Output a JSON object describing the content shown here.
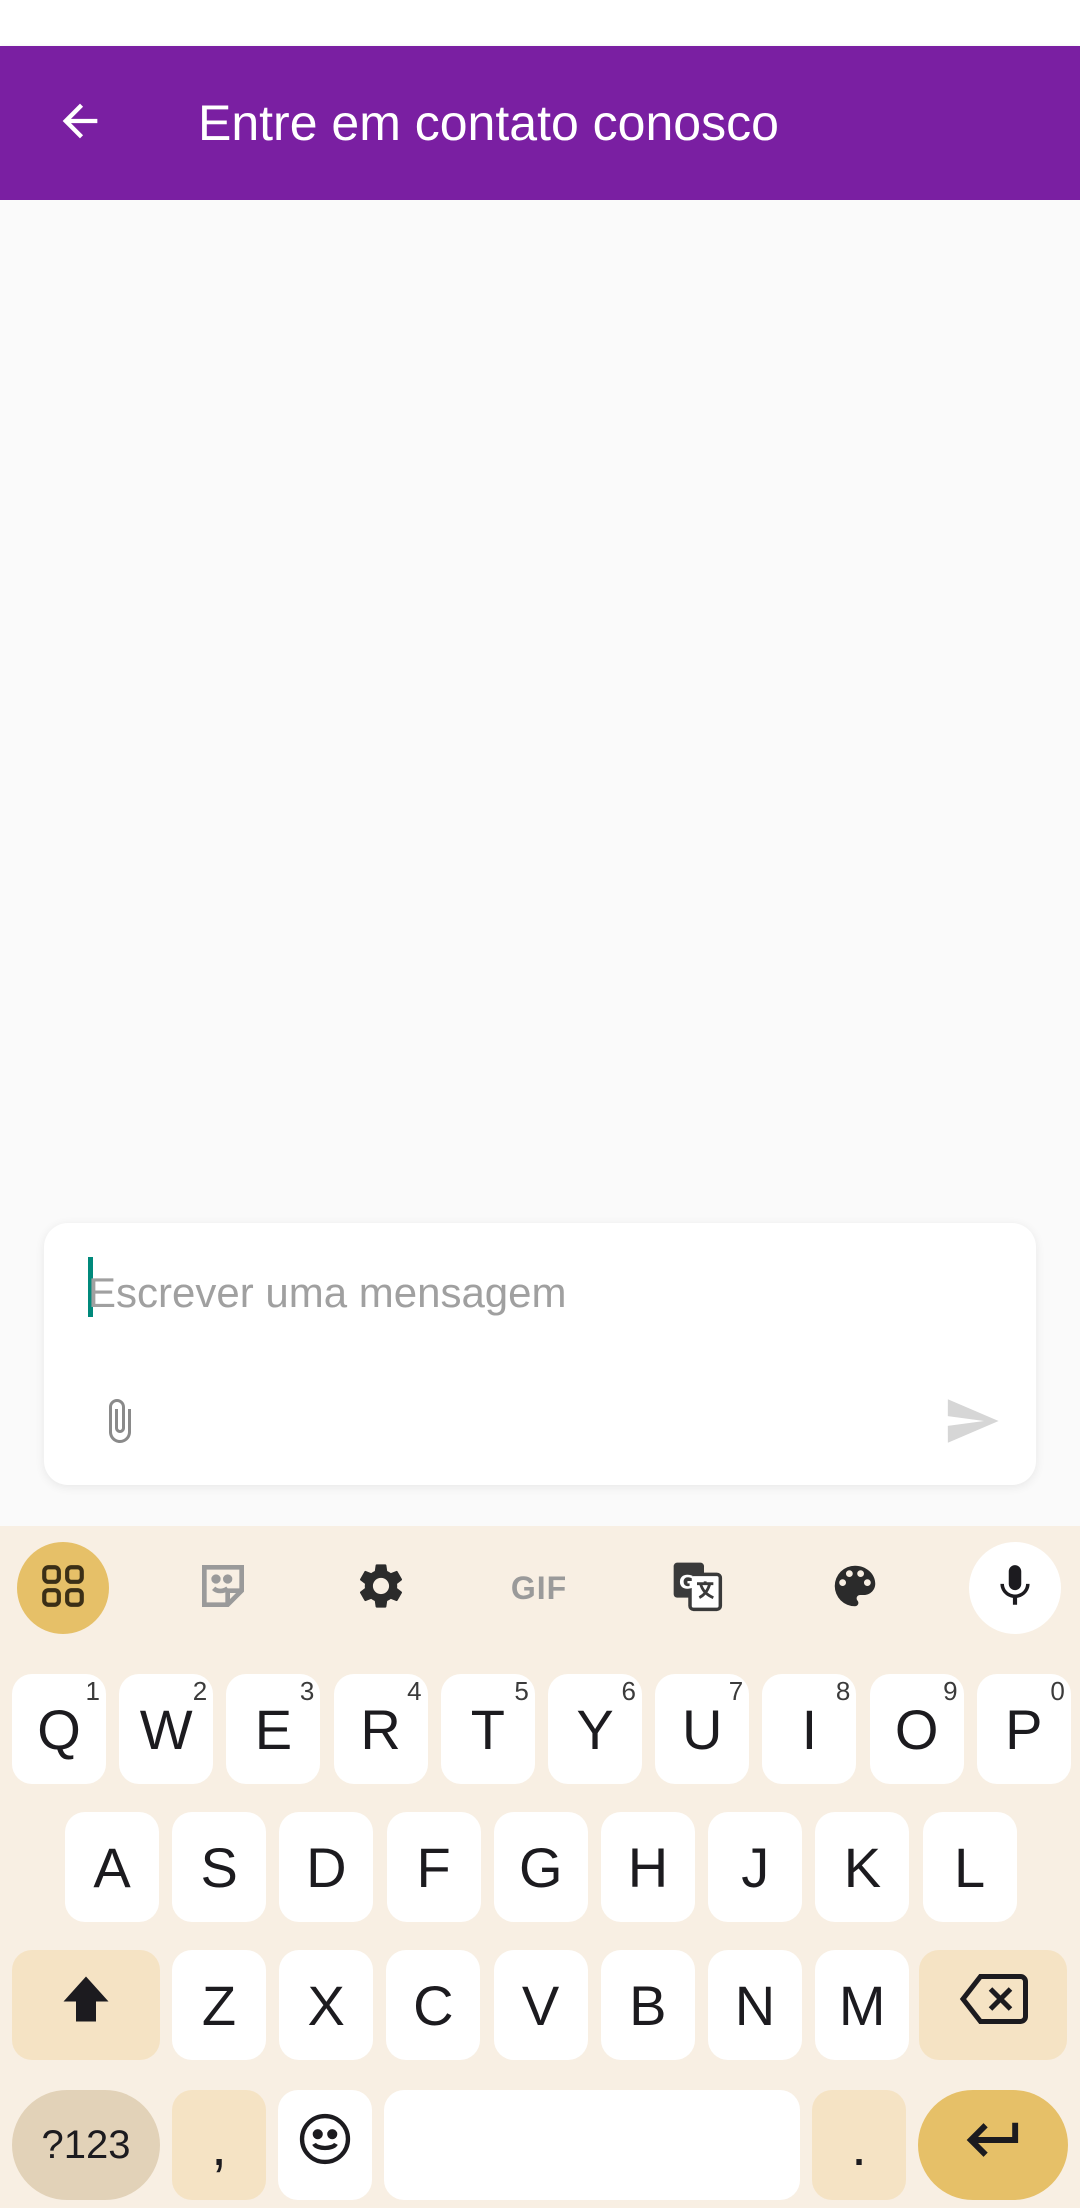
{
  "app_bar": {
    "title": "Entre em contato conosco",
    "back_icon": "arrow-left-icon",
    "background": "#7a1fa2"
  },
  "composer": {
    "placeholder": "Escrever uma mensagem",
    "value": "",
    "attach_icon": "paperclip-icon",
    "send_icon": "send-icon",
    "cursor_color": "#00897b"
  },
  "keyboard": {
    "toolbar": [
      {
        "name": "apps-grid-icon"
      },
      {
        "name": "sticker-icon"
      },
      {
        "name": "gear-icon"
      },
      {
        "name": "gif-button",
        "label": "GIF"
      },
      {
        "name": "translate-icon"
      },
      {
        "name": "palette-icon"
      },
      {
        "name": "microphone-icon"
      }
    ],
    "row1": [
      {
        "label": "Q",
        "hint": "1"
      },
      {
        "label": "W",
        "hint": "2"
      },
      {
        "label": "E",
        "hint": "3"
      },
      {
        "label": "R",
        "hint": "4"
      },
      {
        "label": "T",
        "hint": "5"
      },
      {
        "label": "Y",
        "hint": "6"
      },
      {
        "label": "U",
        "hint": "7"
      },
      {
        "label": "I",
        "hint": "8"
      },
      {
        "label": "O",
        "hint": "9"
      },
      {
        "label": "P",
        "hint": "0"
      }
    ],
    "row2": [
      "A",
      "S",
      "D",
      "F",
      "G",
      "H",
      "J",
      "K",
      "L"
    ],
    "row3": [
      "Z",
      "X",
      "C",
      "V",
      "B",
      "N",
      "M"
    ],
    "row4": {
      "symbols": "?123",
      "comma": ",",
      "period": "."
    },
    "colors": {
      "background": "#f8efe3",
      "key": "#ffffff",
      "special_key": "#f5e3c4",
      "accent": "#e6c068"
    }
  }
}
